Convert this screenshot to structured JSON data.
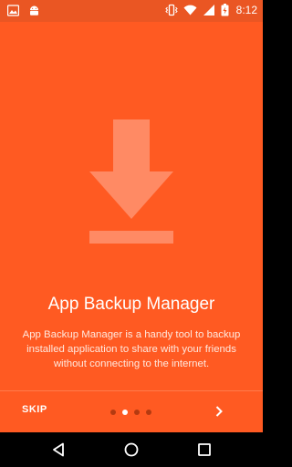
{
  "status_bar": {
    "time": "8:12",
    "icons": [
      "image-notification-icon",
      "android-notification-icon",
      "vibrate-icon",
      "wifi-icon",
      "signal-icon",
      "battery-charging-icon"
    ]
  },
  "onboarding": {
    "icon": "download-icon",
    "title": "App Backup Manager",
    "description": "App Backup Manager is a handy tool to backup installed application to share with your friends without connecting to the internet.",
    "skip_label": "SKIP",
    "next_icon": "chevron-right-icon",
    "page_count": 4,
    "active_page": 2
  },
  "system_nav": {
    "icons": [
      "back-icon",
      "home-icon",
      "recents-icon"
    ]
  },
  "colors": {
    "accent": "#ff5a22",
    "status_bar": "#ea5623",
    "hero_icon": "#ff8a64",
    "inactive_dot": "#b43a10"
  }
}
